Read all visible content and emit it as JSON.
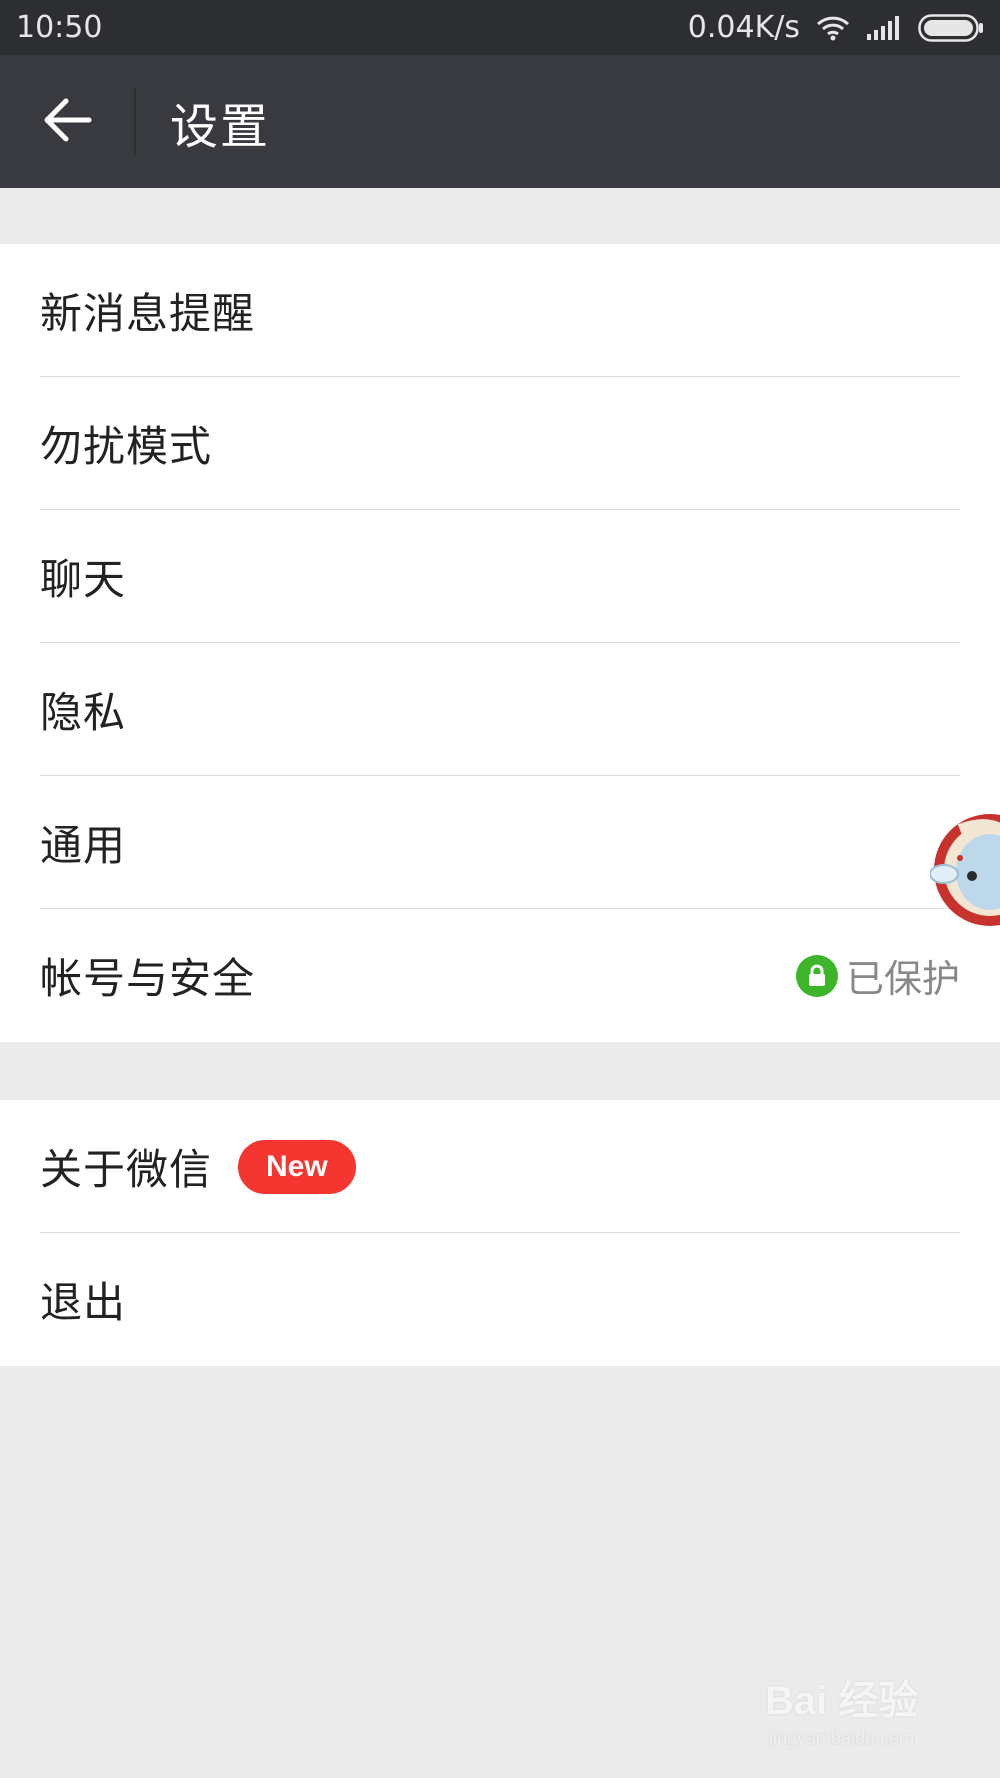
{
  "status_bar": {
    "time": "10:50",
    "speed": "0.04K/s",
    "icons": [
      "wifi-icon",
      "signal-icon",
      "battery-icon"
    ]
  },
  "app_bar": {
    "back_icon": "arrow-left-icon",
    "title": "设置"
  },
  "group1": {
    "items": [
      {
        "label": "新消息提醒"
      },
      {
        "label": "勿扰模式"
      },
      {
        "label": "聊天"
      },
      {
        "label": "隐私"
      },
      {
        "label": "通用"
      },
      {
        "label": "帐号与安全",
        "status": "已保护",
        "status_icon": "lock-icon"
      }
    ]
  },
  "group2": {
    "items": [
      {
        "label": "关于微信",
        "badge": "New"
      },
      {
        "label": "退出"
      }
    ]
  },
  "watermark": {
    "logo": "Bai 经验",
    "url": "jingyan.baidu.com"
  },
  "colors": {
    "status_bar_bg": "#2d2e32",
    "app_bar_bg": "#393a3f",
    "page_bg": "#ebebeb",
    "badge_red": "#f43530",
    "lock_green": "#3cb628"
  }
}
